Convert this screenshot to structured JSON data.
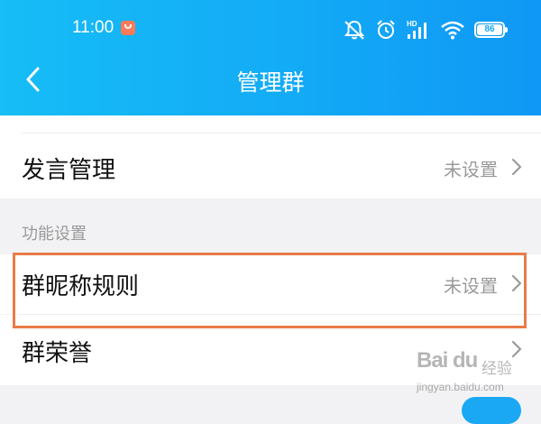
{
  "status_bar": {
    "time": "11:00",
    "battery": "86",
    "signal_label": "HD"
  },
  "header": {
    "title": "管理群",
    "back_icon": "chevron-left-icon"
  },
  "rows": [
    {
      "label": "发言管理",
      "value": "未设置"
    },
    {
      "label": "群昵称规则",
      "value": "未设置"
    },
    {
      "label": "群荣誉",
      "value": ""
    }
  ],
  "section": {
    "label": "功能设置"
  },
  "highlight": {
    "color": "#ea7b48",
    "target": "群昵称规则"
  },
  "watermark": {
    "brand": "Bai du",
    "jingyan": "经验",
    "url": "jingyan.baidu.com"
  },
  "colors": {
    "header_gradient_start": "#16bdf6",
    "header_gradient_end": "#0f98f5",
    "page_background": "#f2f2f4",
    "secondary_text": "#9a9a9a"
  }
}
